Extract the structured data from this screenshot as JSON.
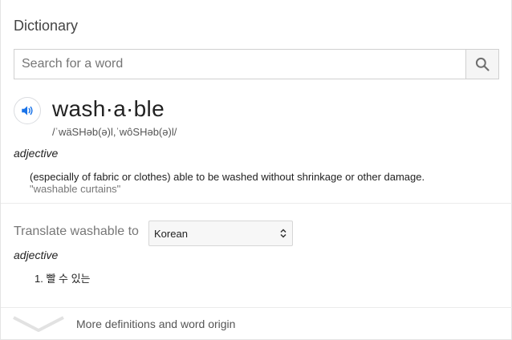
{
  "card": {
    "title": "Dictionary"
  },
  "search": {
    "placeholder": "Search for a word",
    "value": "",
    "button_icon": "search-icon"
  },
  "entry": {
    "speaker_icon": "speaker-icon",
    "headword": "wash·a·ble",
    "phonetic": "/ˈwäSHəb(ə)l,ˈwôSHəb(ə)l/",
    "senses": [
      {
        "part_of_speech": "adjective",
        "definition": "(especially of fabric or clothes) able to be washed without shrinkage or other damage.",
        "example": "\"washable curtains\""
      }
    ]
  },
  "translate": {
    "label": "Translate washable to",
    "selected_language": "Korean",
    "part_of_speech": "adjective",
    "results": [
      "1. 빨 수 있는"
    ]
  },
  "footer": {
    "expand_icon": "chevron-down-icon",
    "more_label": "More definitions and word origin"
  },
  "colors": {
    "speaker_blue": "#1a73e8",
    "border": "#d0d0d0",
    "divider": "#ebebeb"
  }
}
